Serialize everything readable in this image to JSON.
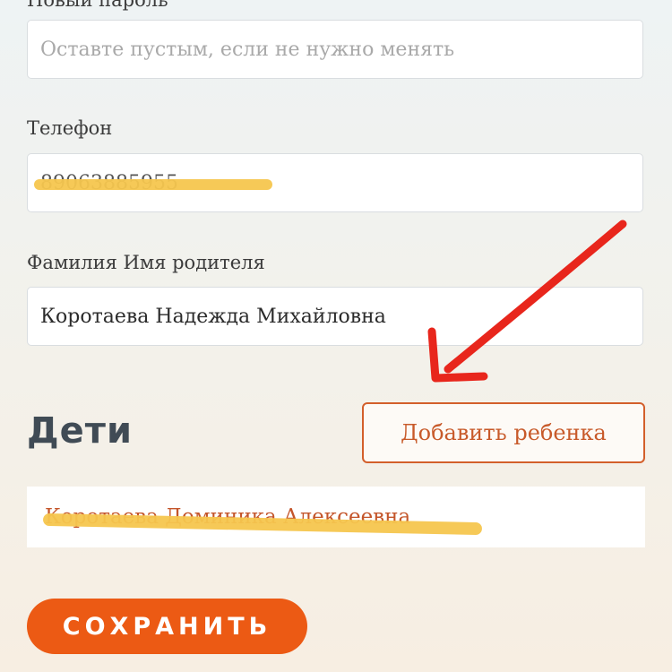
{
  "form": {
    "password_label": "Новый пароль",
    "password_placeholder": "Оставте пустым, если не нужно менять",
    "phone_label": "Телефон",
    "phone_value": "89063885955",
    "parent_label": "Фамилия Имя родителя",
    "parent_value": "Коротаева Надежда Михайловна"
  },
  "children": {
    "title": "Дети",
    "add_button": "Добавить ребенка",
    "items": [
      "Коротаева Доминика Алексеевна"
    ]
  },
  "save_button": "СОХРАНИТЬ",
  "colors": {
    "accent": "#ec5a14",
    "annotation_arrow": "#e8261c",
    "redaction_marker": "#f5c64e"
  }
}
